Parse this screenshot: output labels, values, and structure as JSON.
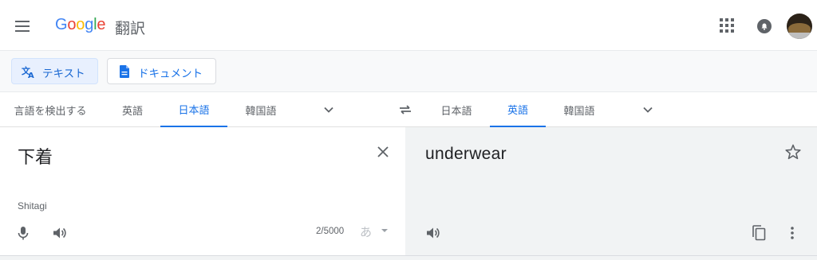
{
  "header": {
    "logo": "Google",
    "product": "翻訳",
    "icons": [
      "menu-icon",
      "apps-grid-icon",
      "notification-bell-icon",
      "account-avatar"
    ]
  },
  "modes": {
    "text_label": "テキスト",
    "document_label": "ドキュメント"
  },
  "source_langs": {
    "detect": "言語を検出する",
    "items": [
      "英語",
      "日本語",
      "韓国語"
    ],
    "active": "日本語"
  },
  "target_langs": {
    "items": [
      "日本語",
      "英語",
      "韓国語"
    ],
    "active": "英語"
  },
  "source": {
    "text": "下着",
    "transliteration": "Shitagi",
    "char_count": "2/5000",
    "ime_label": "あ"
  },
  "target": {
    "text": "underwear"
  },
  "colors": {
    "accent": "#1a73e8",
    "icon": "#5f6368",
    "panel_gray": "#f1f3f4"
  }
}
